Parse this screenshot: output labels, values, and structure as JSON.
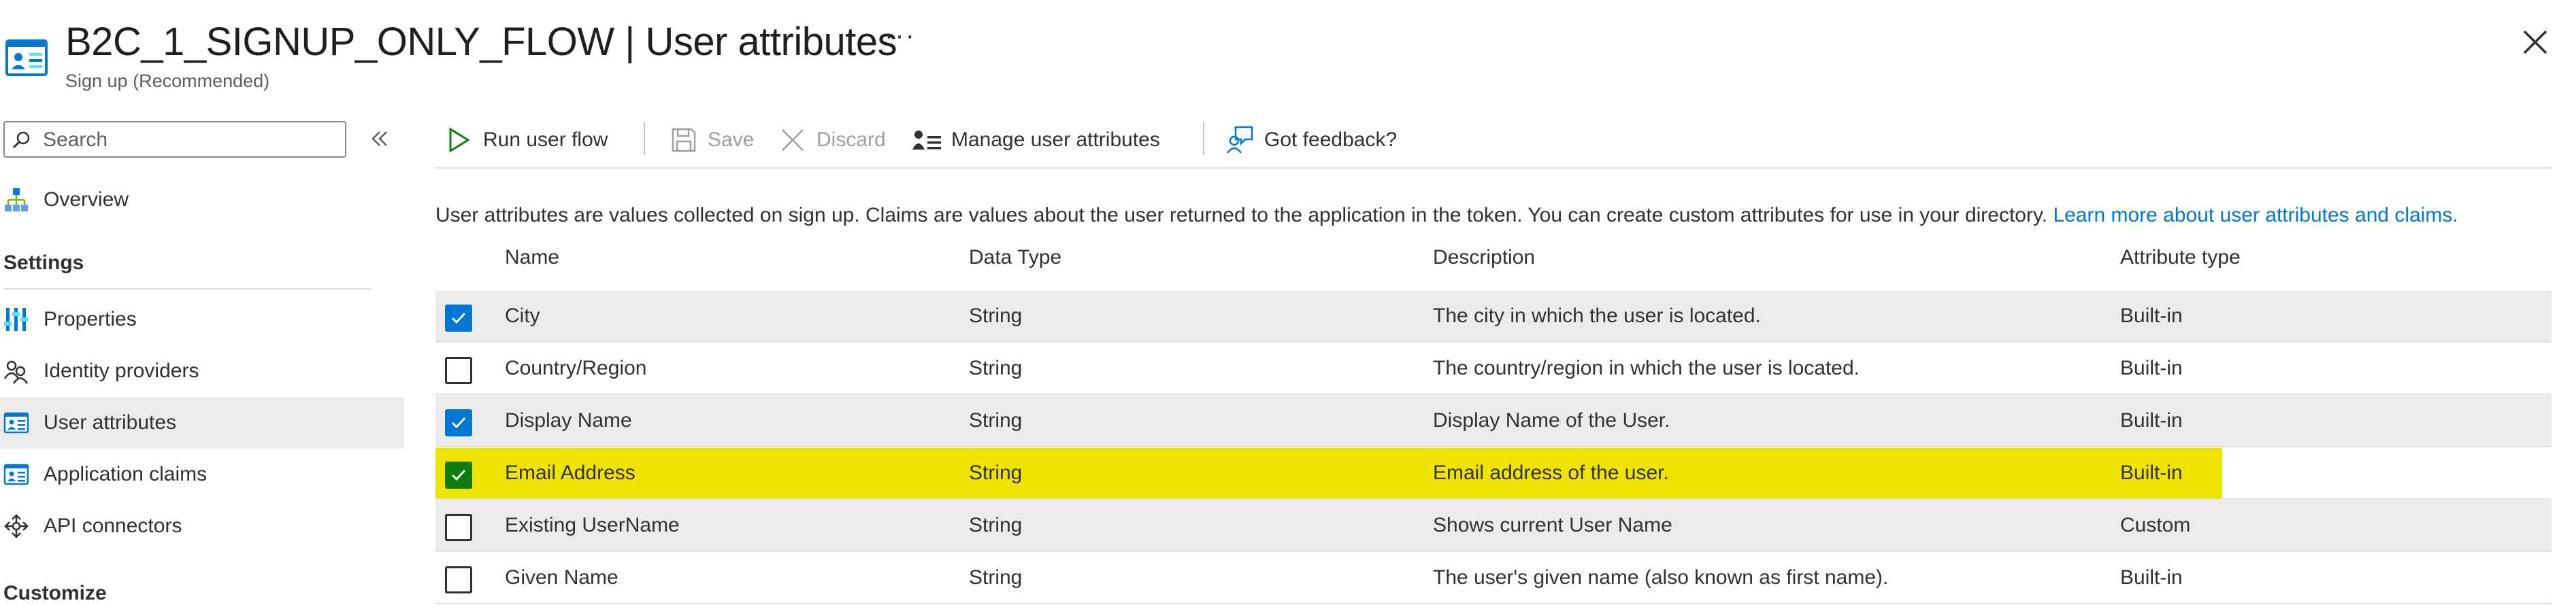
{
  "header": {
    "title_main": "B2C_1_SIGNUP_ONLY_FLOW",
    "title_sep": " | ",
    "title_sub": "User attributes",
    "subtitle": "Sign up (Recommended)",
    "more": "···"
  },
  "sidebar": {
    "search_placeholder": "Search",
    "overview": "Overview",
    "settings_heading": "Settings",
    "items": [
      {
        "label": "Properties",
        "icon": "properties-icon"
      },
      {
        "label": "Identity providers",
        "icon": "identity-providers-icon"
      },
      {
        "label": "User attributes",
        "icon": "user-attributes-icon",
        "selected": true
      },
      {
        "label": "Application claims",
        "icon": "application-claims-icon"
      },
      {
        "label": "API connectors",
        "icon": "api-connectors-icon"
      }
    ],
    "customize_heading": "Customize"
  },
  "toolbar": {
    "run": "Run user flow",
    "save": "Save",
    "discard": "Discard",
    "manage": "Manage user attributes",
    "feedback": "Got feedback?"
  },
  "content": {
    "info_text": "User attributes are values collected on sign up. Claims are values about the user returned to the application in the token. You can create custom attributes for use in your directory. ",
    "info_link": "Learn more about user attributes and claims.",
    "columns": [
      "Name",
      "Data Type",
      "Description",
      "Attribute type"
    ],
    "rows": [
      {
        "name": "City",
        "type": "String",
        "description": "The city in which the user is located.",
        "attr": "Built-in",
        "checked": true
      },
      {
        "name": "Country/Region",
        "type": "String",
        "description": "The country/region in which the user is located.",
        "attr": "Built-in",
        "checked": false
      },
      {
        "name": "Display Name",
        "type": "String",
        "description": "Display Name of the User.",
        "attr": "Built-in",
        "checked": true
      },
      {
        "name": "Email Address",
        "type": "String",
        "description": "Email address of the user.",
        "attr": "Built-in",
        "checked": true,
        "highlighted": true
      },
      {
        "name": "Existing UserName",
        "type": "String",
        "description": "Shows current User Name",
        "attr": "Custom",
        "checked": false
      },
      {
        "name": "Given Name",
        "type": "String",
        "description": "The user's given name (also known as first name).",
        "attr": "Built-in",
        "checked": false
      }
    ]
  },
  "colors": {
    "accent": "#0078d4",
    "highlight": "#eee400",
    "checked_green": "#107c10",
    "selected_bg": "#edebe9"
  }
}
